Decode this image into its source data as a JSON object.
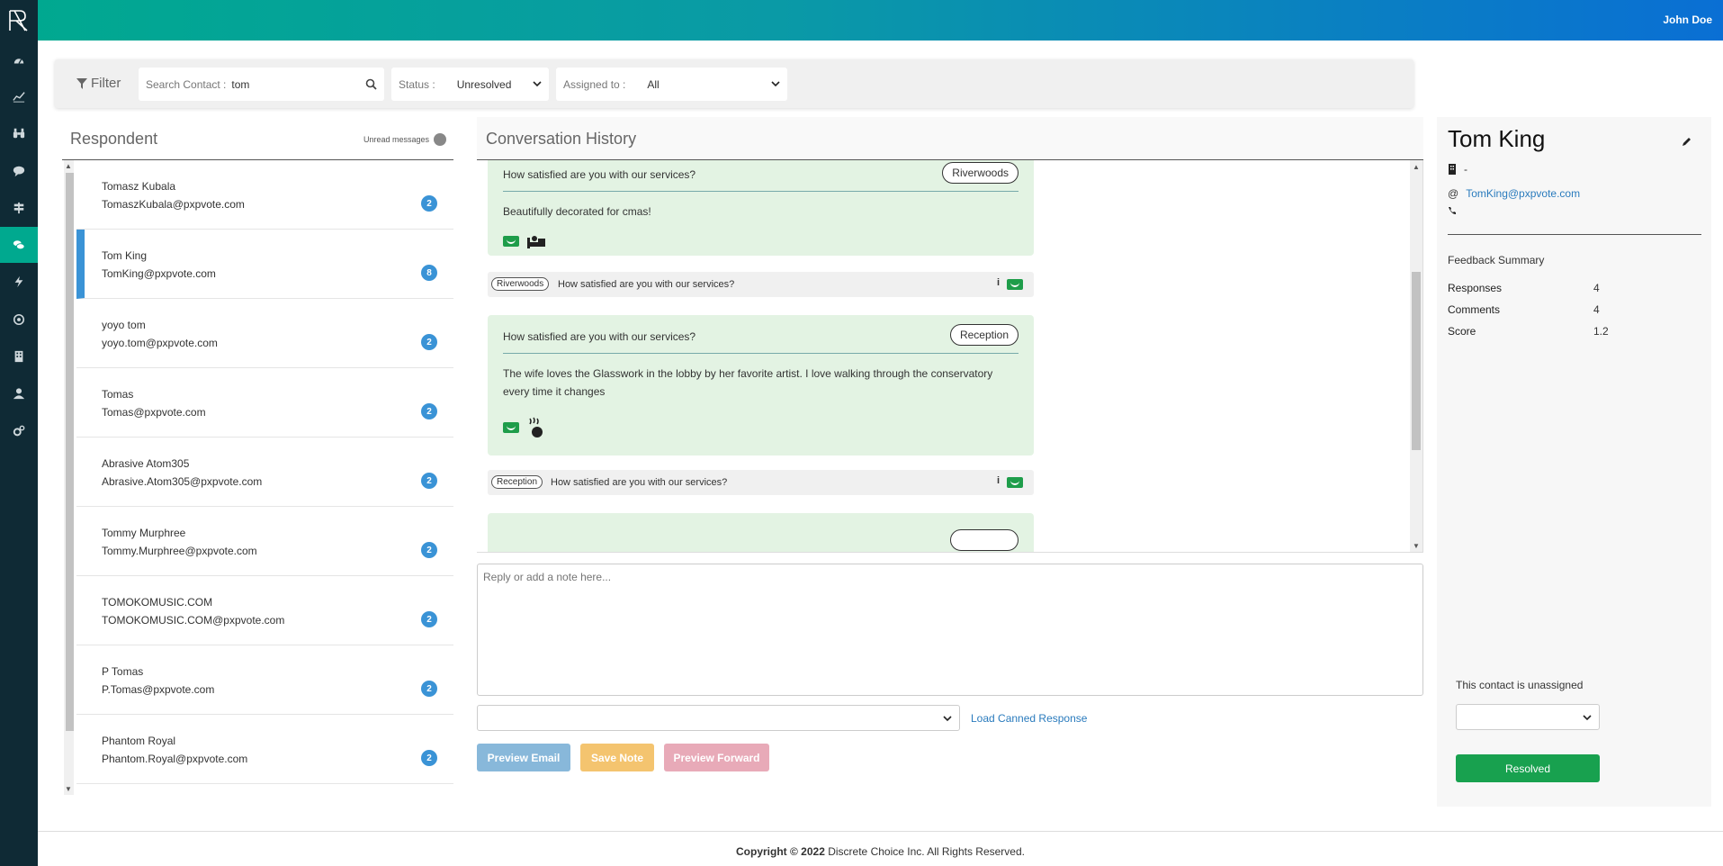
{
  "app": {
    "user_name": "John Doe"
  },
  "sidebar": {
    "items": [
      {
        "icon": "dashboard-icon"
      },
      {
        "icon": "chart-line-icon"
      },
      {
        "icon": "binoculars-icon"
      },
      {
        "icon": "comment-icon"
      },
      {
        "icon": "signpost-icon"
      },
      {
        "icon": "comments-icon",
        "active": true
      },
      {
        "icon": "bolt-icon"
      },
      {
        "icon": "target-icon"
      },
      {
        "icon": "building-icon"
      },
      {
        "icon": "user-icon"
      },
      {
        "icon": "cogs-icon"
      }
    ]
  },
  "filter": {
    "label": "Filter",
    "search_label": "Search Contact :",
    "search_value": "tom",
    "status_label": "Status :",
    "status_value": "Unresolved",
    "assigned_label": "Assigned to :",
    "assigned_value": "All"
  },
  "respondents": {
    "title": "Respondent",
    "unread_label": "Unread messages",
    "items": [
      {
        "name": "Tomasz Kubala",
        "email": "TomaszKubala@pxpvote.com",
        "count": "2"
      },
      {
        "name": "Tom King",
        "email": "TomKing@pxpvote.com",
        "count": "8",
        "selected": true
      },
      {
        "name": "yoyo tom",
        "email": "yoyo.tom@pxpvote.com",
        "count": "2"
      },
      {
        "name": "Tomas",
        "email": "Tomas@pxpvote.com",
        "count": "2"
      },
      {
        "name": "Abrasive Atom305",
        "email": "Abrasive.Atom305@pxpvote.com",
        "count": "2"
      },
      {
        "name": "Tommy Murphree",
        "email": "Tommy.Murphree@pxpvote.com",
        "count": "2"
      },
      {
        "name": "TOMOKOMUSIC.COM",
        "email": "TOMOKOMUSIC.COM@pxpvote.com",
        "count": "2"
      },
      {
        "name": "P Tomas",
        "email": "P.Tomas@pxpvote.com",
        "count": "2"
      },
      {
        "name": "Phantom Royal",
        "email": "Phantom.Royal@pxpvote.com",
        "count": "2"
      }
    ]
  },
  "conversation": {
    "title": "Conversation History",
    "messages": [
      {
        "question": "How satisfied are you with our services?",
        "tag": "Riverwoods",
        "comment": "Beautifully decorated for cmas!",
        "summary_tag": "Riverwoods",
        "summary_question": "How satisfied are you with our services?",
        "info": "i"
      },
      {
        "question": "How satisfied are you with our services?",
        "tag": "Reception",
        "comment": "The wife loves the Glasswork in the lobby by her favorite artist. I love walking through the conservatory every time it changes",
        "summary_tag": "Reception",
        "summary_question": "How satisfied are you with our services?",
        "info": "i"
      }
    ],
    "reply_placeholder": "Reply or add a note here...",
    "load_canned": "Load Canned Response",
    "btn_preview_email": "Preview Email",
    "btn_save_note": "Save Note",
    "btn_preview_forward": "Preview Forward"
  },
  "contact": {
    "name": "Tom King",
    "company": "-",
    "email": "TomKing@pxpvote.com",
    "phone": "",
    "feedback_title": "Feedback Summary",
    "stats": [
      {
        "label": "Responses",
        "value": "4"
      },
      {
        "label": "Comments",
        "value": "4"
      },
      {
        "label": "Score",
        "value": "1.2"
      }
    ],
    "unassigned_text": "This contact is unassigned",
    "resolved_label": "Resolved"
  },
  "footer": {
    "copyright": "Copyright © 2022",
    "company": "Discrete Choice Inc. All Rights Reserved."
  },
  "colors": {
    "brand_teal": "#00a98f",
    "brand_blue": "#0a6fd4",
    "sidebar_bg": "#0f2a35",
    "badge_blue": "#3a93d6",
    "message_green": "#e3f3e3",
    "resolved_green": "#18a14f"
  }
}
